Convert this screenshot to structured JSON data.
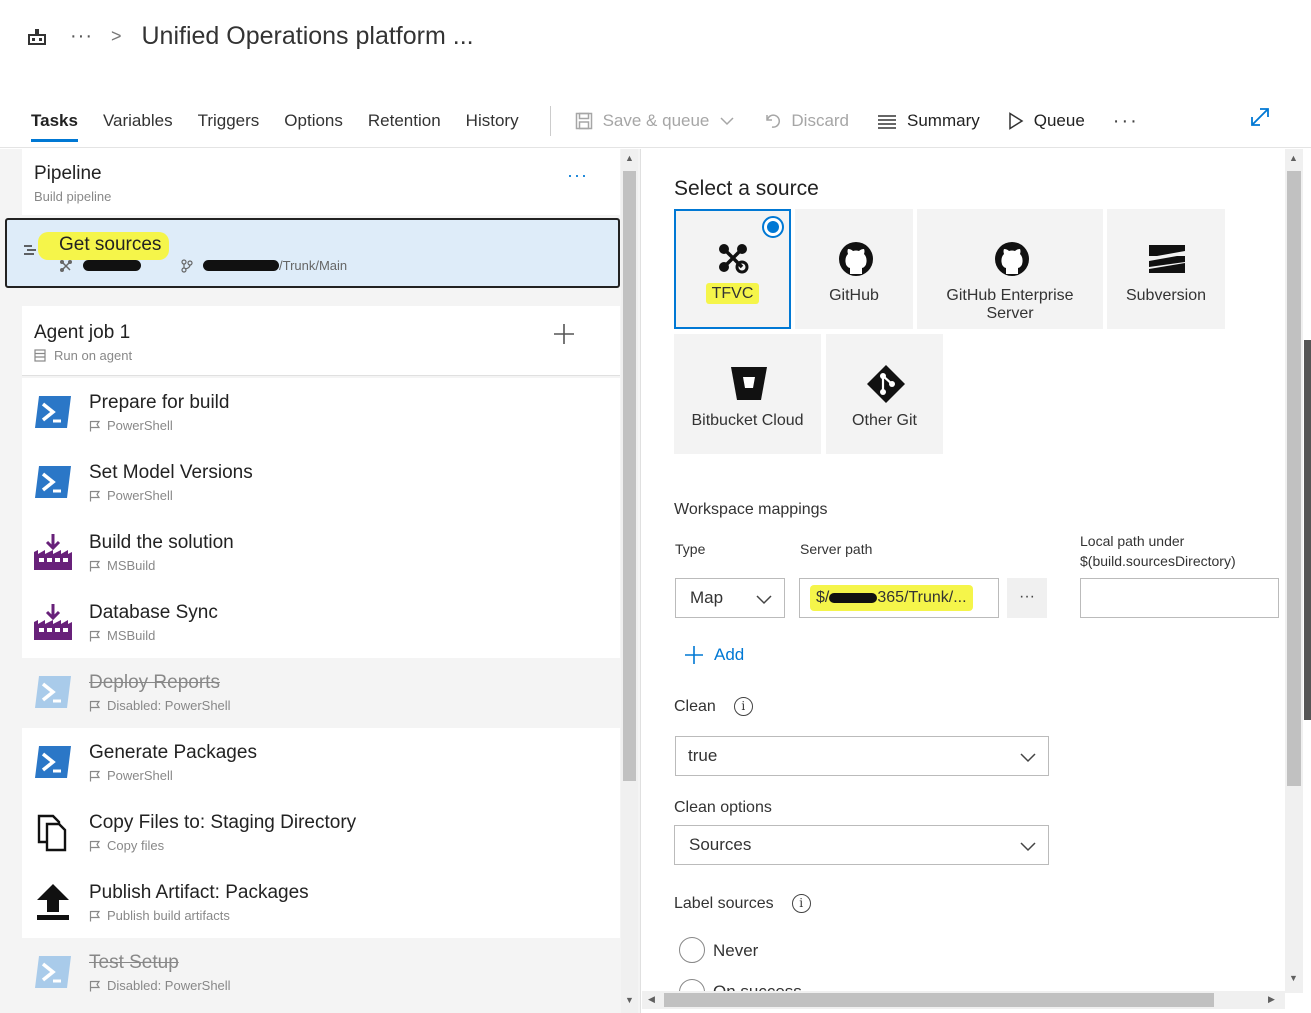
{
  "header": {
    "breadcrumb_dots": "···",
    "breadcrumb_chevron": ">",
    "title": "Unified Operations platform ...",
    "tabs": [
      "Tasks",
      "Variables",
      "Triggers",
      "Options",
      "Retention",
      "History"
    ],
    "toolbar": {
      "save_queue": "Save & queue",
      "discard": "Discard",
      "summary": "Summary",
      "queue": "Queue",
      "more": "···"
    }
  },
  "left": {
    "pipeline": {
      "title": "Pipeline",
      "subtitle": "Build pipeline",
      "more": "···"
    },
    "get_sources": {
      "title": "Get sources",
      "repo_path": "/Trunk/Main"
    },
    "agent_job": {
      "title": "Agent job 1",
      "subtitle": "Run on agent"
    },
    "tasks": [
      {
        "title": "Prepare for build",
        "subtitle": "PowerShell",
        "icon": "powershell-icon",
        "disabled": false
      },
      {
        "title": "Set Model Versions",
        "subtitle": "PowerShell",
        "icon": "powershell-icon",
        "disabled": false
      },
      {
        "title": "Build the solution",
        "subtitle": "MSBuild",
        "icon": "msbuild-icon",
        "disabled": false
      },
      {
        "title": "Database Sync",
        "subtitle": "MSBuild",
        "icon": "msbuild-icon",
        "disabled": false
      },
      {
        "title": "Deploy Reports",
        "subtitle": "Disabled: PowerShell",
        "icon": "powershell-icon",
        "disabled": true
      },
      {
        "title": "Generate Packages",
        "subtitle": "PowerShell",
        "icon": "powershell-icon",
        "disabled": false
      },
      {
        "title": "Copy Files to: Staging Directory",
        "subtitle": "Copy files",
        "icon": "copy-files-icon",
        "disabled": false
      },
      {
        "title": "Publish Artifact: Packages",
        "subtitle": "Publish build artifacts",
        "icon": "publish-artifact-icon",
        "disabled": false
      },
      {
        "title": "Test Setup",
        "subtitle": "Disabled: PowerShell",
        "icon": "powershell-icon",
        "disabled": true
      }
    ]
  },
  "right": {
    "select_source_title": "Select a source",
    "sources": [
      {
        "label": "TFVC",
        "icon": "tfvc-icon",
        "selected": true
      },
      {
        "label": "GitHub",
        "icon": "github-icon",
        "selected": false
      },
      {
        "label": "GitHub Enterprise Server",
        "icon": "github-enterprise-icon",
        "selected": false
      },
      {
        "label": "Subversion",
        "icon": "subversion-icon",
        "selected": false
      },
      {
        "label": "Bitbucket Cloud",
        "icon": "bitbucket-icon",
        "selected": false
      },
      {
        "label": "Other Git",
        "icon": "git-icon",
        "selected": false
      }
    ],
    "workspace": {
      "title": "Workspace mappings",
      "type_label": "Type",
      "server_path_label": "Server path",
      "local_path_label_1": "Local path under",
      "local_path_label_2": "$(build.sourcesDirectory)",
      "type_value": "Map",
      "server_path_prefix": "$/",
      "server_path_suffix": "365/Trunk/...",
      "server_path_more": "···",
      "local_path_value": "",
      "add_label": "Add"
    },
    "clean": {
      "label": "Clean",
      "value": "true"
    },
    "clean_options": {
      "label": "Clean options",
      "value": "Sources"
    },
    "label_sources": {
      "label": "Label sources",
      "options": [
        "Never",
        "On success"
      ]
    }
  },
  "colors": {
    "accent": "#0078d4",
    "highlight": "#f5f54a",
    "selected_bg": "#deecf9",
    "msbuild": "#68217a",
    "powershell": "#2b77c7"
  }
}
